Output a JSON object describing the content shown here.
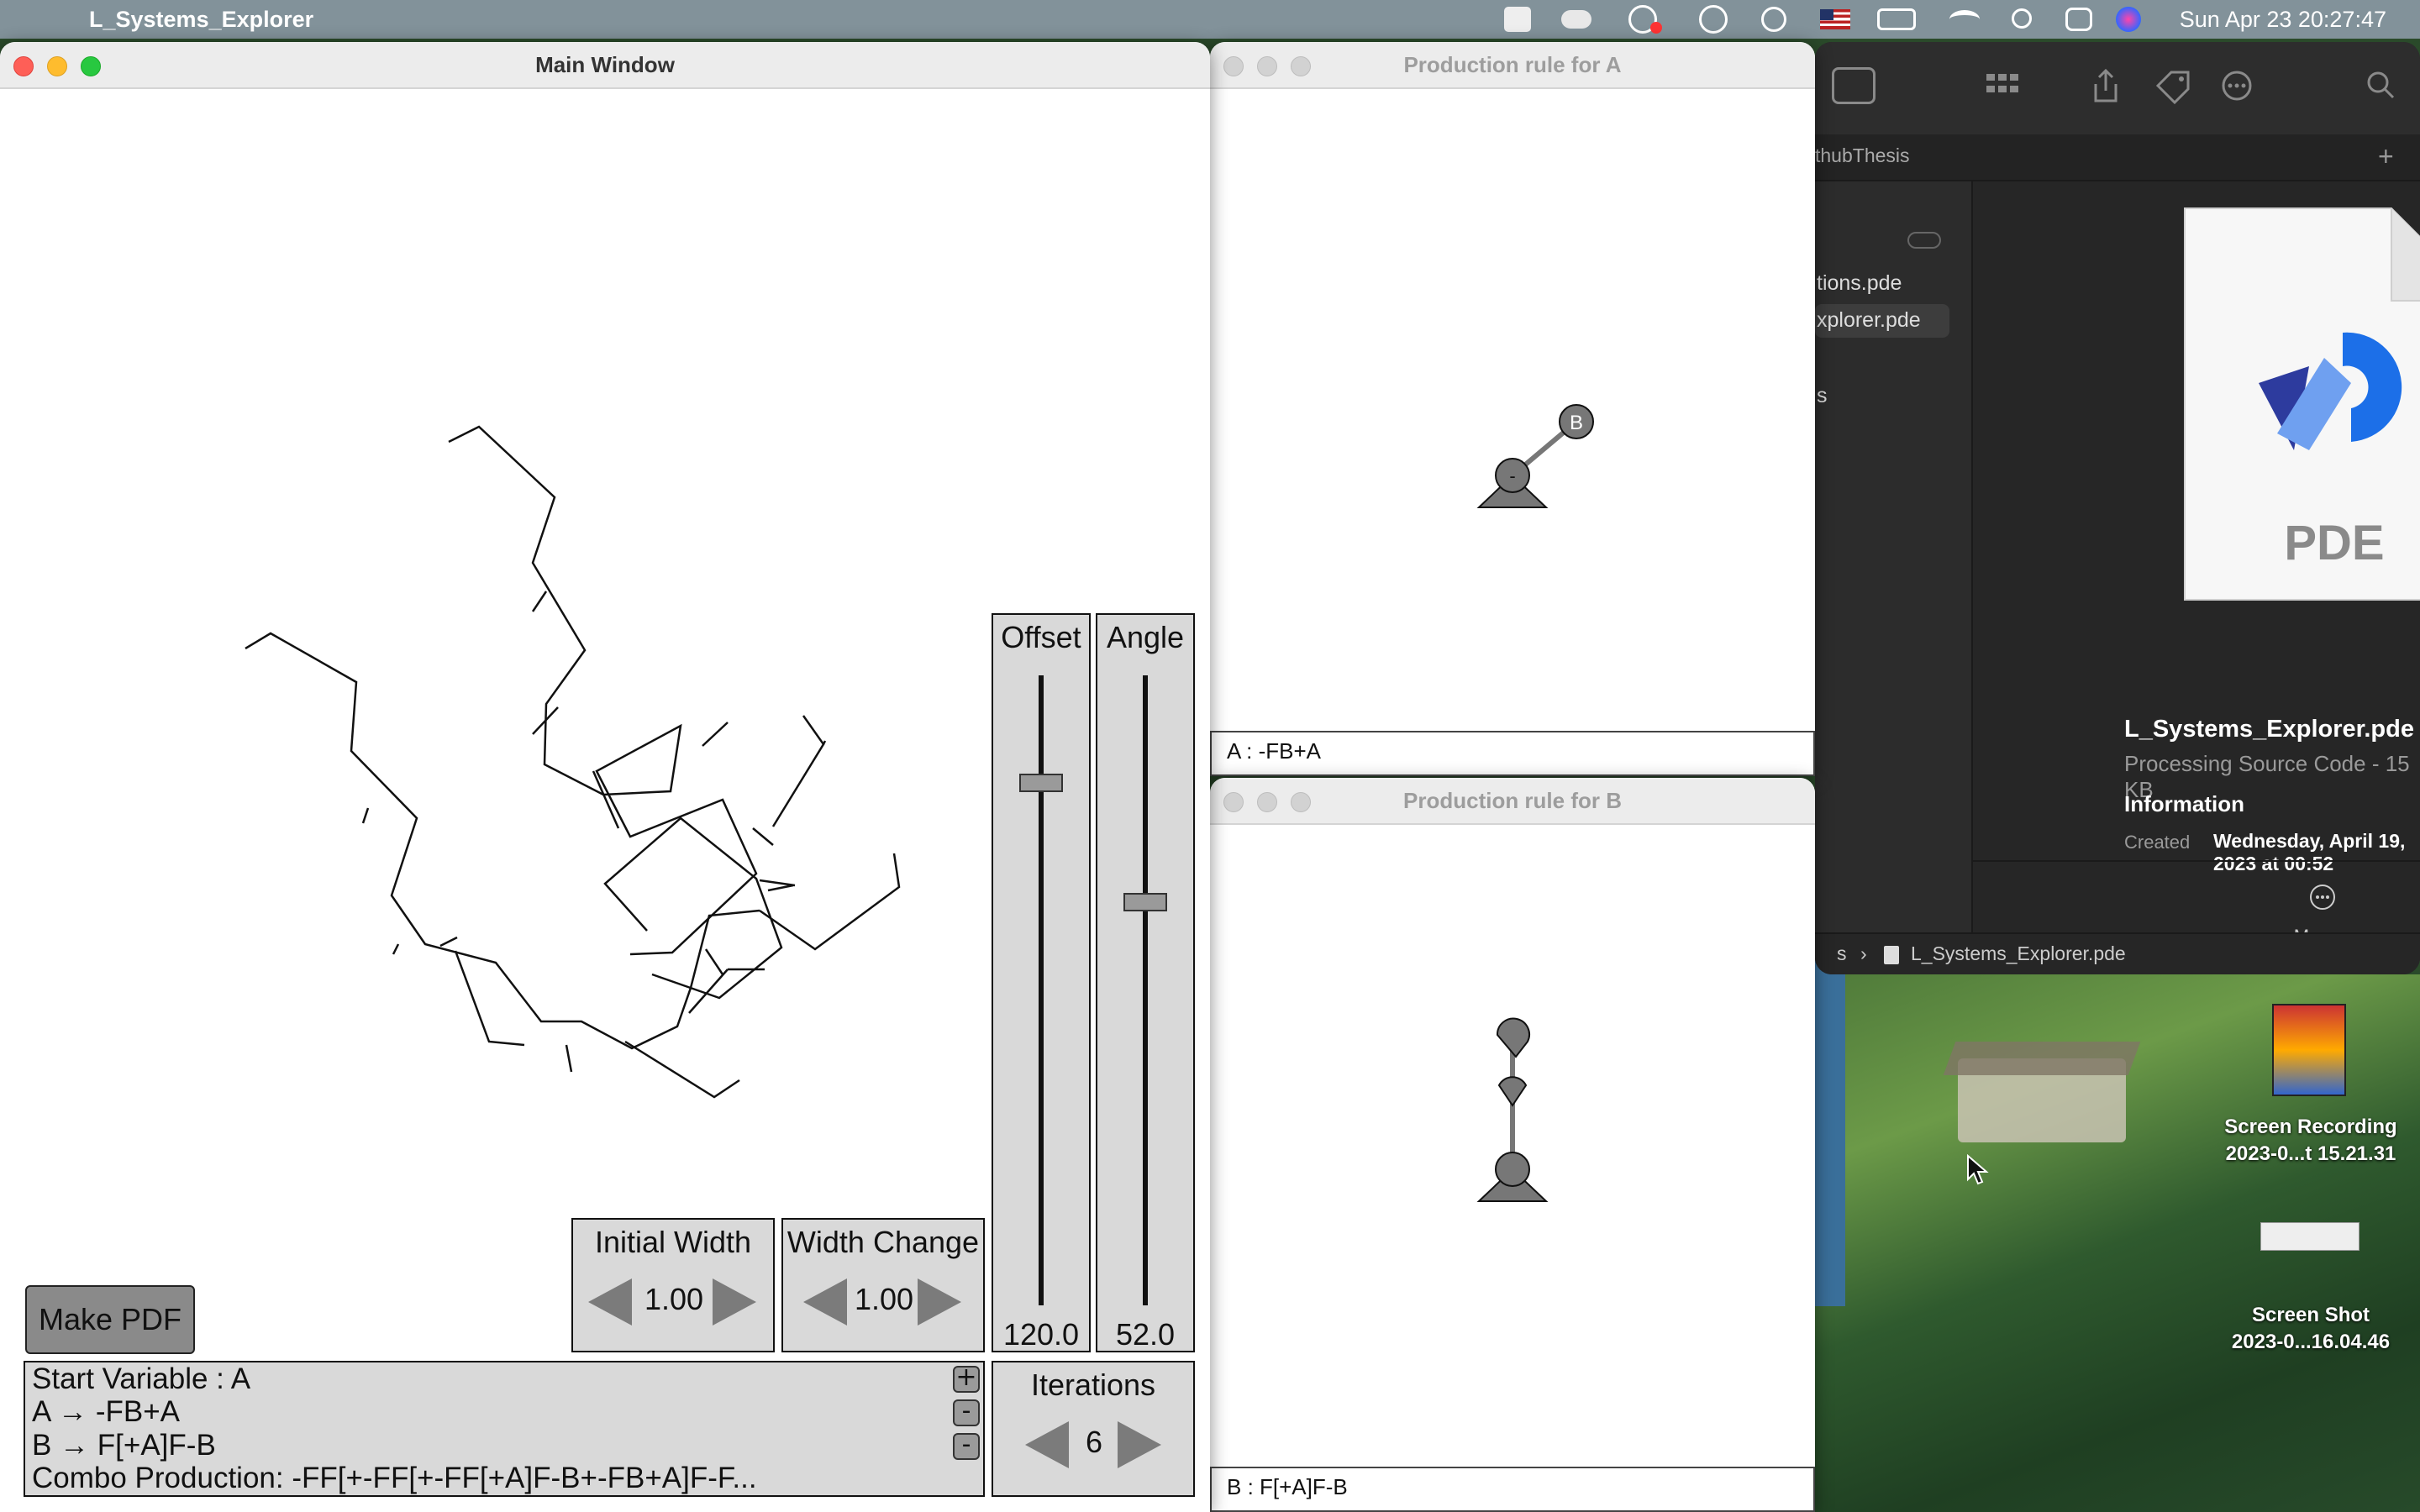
{
  "menubar": {
    "app_name": "L_Systems_Explorer",
    "clock": "Sun Apr 23  20:27:47",
    "icons": [
      "creative-cloud-icon",
      "icloud-icon",
      "screen-record-icon",
      "sync-icon",
      "play-icon",
      "flag-icon",
      "battery-icon",
      "wifi-icon",
      "search-icon",
      "control-center-icon",
      "siri-icon"
    ]
  },
  "main_window": {
    "title": "Main Window",
    "make_pdf_label": "Make PDF",
    "initial_width": {
      "label": "Initial Width",
      "value": "1.00"
    },
    "width_change": {
      "label": "Width Change",
      "value": "1.00"
    },
    "offset": {
      "label": "Offset",
      "value": "120.0",
      "level": 0.17
    },
    "angle": {
      "label": "Angle",
      "value": "52.0",
      "level": 0.36
    },
    "iterations": {
      "label": "Iterations",
      "value": "6"
    },
    "rules": {
      "start": "Start Variable : A",
      "rule_a": "A → -FB+A",
      "rule_b": "B → F[+A]F-B",
      "combo": "Combo Production: -FF[+-FF[+-FF[+A]F-B+-FB+A]F-F..."
    },
    "rule_buttons": [
      "+",
      "-",
      "-"
    ]
  },
  "prod_a": {
    "title": "Production rule for A",
    "rule_text": "A : -FB+A",
    "node_label": "B",
    "root_symbol": "-"
  },
  "prod_b": {
    "title": "Production rule for B",
    "rule_text": "B : F[+A]F-B"
  },
  "finder": {
    "tab_label": "thubThesis",
    "sidebar_items": [
      "tions.pde",
      "xplorer.pde",
      "s"
    ],
    "file_name": "L_Systems_Explorer.pde",
    "file_desc": "Processing Source Code - 15 KB",
    "info_heading": "Information",
    "created_label": "Created",
    "created_value": "Wednesday, April 19, 2023 at 00:52",
    "more_label": "More...",
    "doc_badge": "PDE",
    "path_prefix": "s",
    "path_file": "L_Systems_Explorer.pde"
  },
  "desktop": {
    "items": [
      {
        "line1": "Screen Recording",
        "line2": "2023-0...t 15.21.31"
      },
      {
        "line1": "Screen Shot",
        "line2": "2023-0...16.04.46"
      }
    ]
  }
}
